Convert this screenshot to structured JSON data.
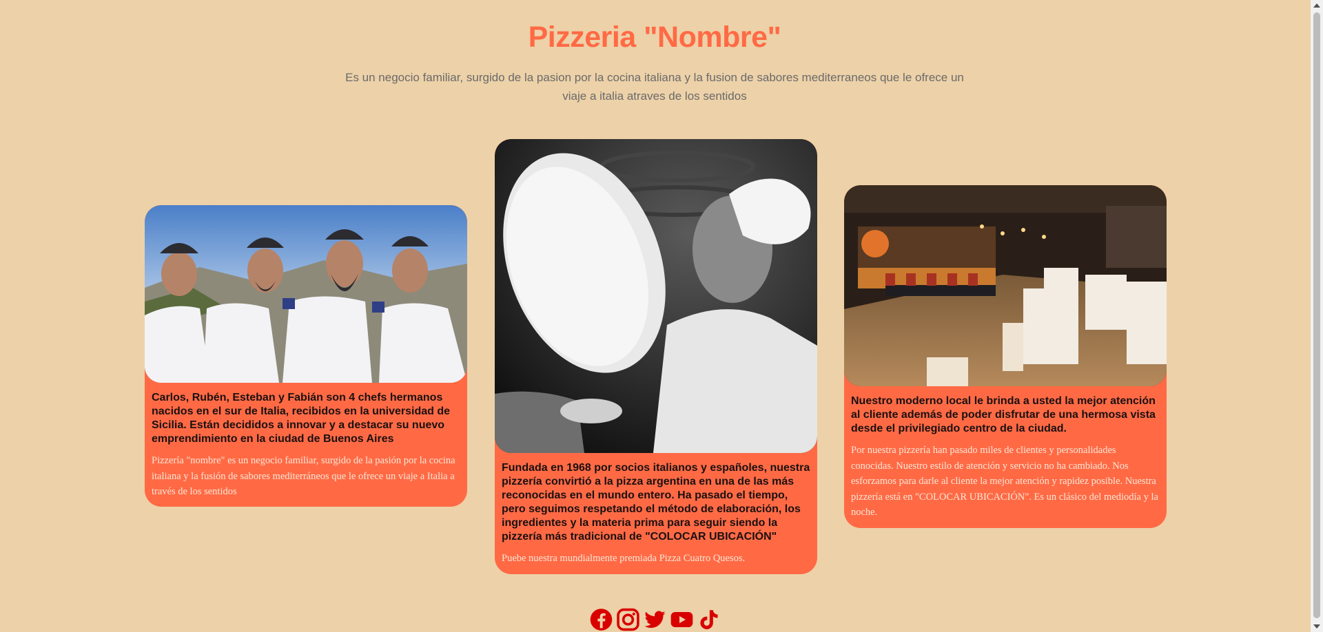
{
  "header": {
    "title": "Pizzeria \"Nombre\"",
    "subtitle": "Es un negocio familiar, surgido de la pasion por la cocina italiana y la fusion de sabores mediterraneos que le ofrece un viaje a italia atraves de los sentidos"
  },
  "cards": [
    {
      "image": "chefs-photo",
      "heading": "Carlos, Rubén, Esteban y Fabián son 4 chefs hermanos nacidos en el sur de Italia, recibidos en la universidad de Sicilia. Están decididos a innovar y a destacar su nuevo emprendimiento en la ciudad de Buenos Aires",
      "body": "Pizzería \"nombre\" es un negocio familiar, surgido de la pasión por la cocina italiana y la fusión de sabores mediterráneos que le ofrece un viaje a Italia a través de los sentidos"
    },
    {
      "image": "pizza-maker-photo",
      "heading": "Fundada en 1968 por socios italianos y españoles, nuestra pizzería convirtió a la pizza argentina en una de las más reconocidas en el mundo entero. Ha pasado el tiempo, pero seguimos respetando el método de elaboración, los ingredientes y la materia prima para seguir siendo la pizzería más tradicional de \"COLOCAR UBICACIÓN\"",
      "body": "Puebe nuestra mundialmente premiada Pizza Cuatro Quesos."
    },
    {
      "image": "restaurant-interior-photo",
      "heading": "Nuestro moderno local le brinda a usted la mejor atención al cliente además de poder disfrutar de una hermosa vista desde el privilegiado centro de la ciudad.",
      "body": "Por nuestra pizzería han pasado miles de clientes y personalidades conocidas. Nuestro estilo de atención y servicio no ha cambiado. Nos esforzamos para darle al cliente la mejor atención y rapidez posible. Nuestra pizzería está en \"COLOCAR UBICACIÓN\". Es un clásico del mediodía y la noche."
    }
  ],
  "social": {
    "icons": [
      "facebook-icon",
      "instagram-icon",
      "twitter-icon",
      "youtube-icon",
      "tiktok-icon"
    ],
    "color": "#d90000"
  },
  "colors": {
    "background": "#edd1a8",
    "accent": "#ff6a45",
    "heading_text": "#1a1010",
    "body_text": "#fbe6d6"
  }
}
